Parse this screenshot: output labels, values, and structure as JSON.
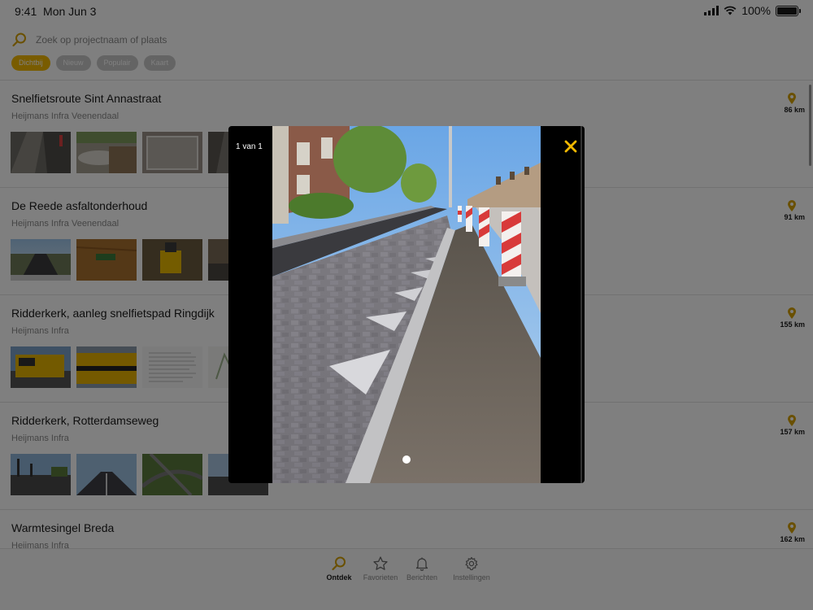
{
  "status": {
    "time": "9:41",
    "date": "Mon Jun 3",
    "battery": "100%"
  },
  "search": {
    "placeholder": "Zoek op projectnaam of plaats"
  },
  "filters": [
    {
      "label": "Dichtbij",
      "active": true
    },
    {
      "label": "Nieuw",
      "active": false
    },
    {
      "label": "Populair",
      "active": false
    },
    {
      "label": "Kaart",
      "active": false
    }
  ],
  "projects": [
    {
      "title": "Snelfietsroute Sint Annastraat",
      "company": "Heijmans Infra Veenendaal",
      "distance": "86 km"
    },
    {
      "title": "De Reede asfaltonderhoud",
      "company": "Heijmans Infra Veenendaal",
      "distance": "91 km"
    },
    {
      "title": "Ridderkerk, aanleg snelfietspad Ringdijk",
      "company": "Heijmans Infra",
      "distance": "155 km"
    },
    {
      "title": "Ridderkerk, Rotterdamseweg",
      "company": "Heijmans Infra",
      "distance": "157 km"
    },
    {
      "title": "Warmtesingel Breda",
      "company": "Heijmans Infra",
      "distance": "162 km"
    }
  ],
  "tabs": [
    {
      "label": "Ontdek",
      "icon": "search-icon",
      "active": true
    },
    {
      "label": "Favorieten",
      "icon": "star-icon",
      "active": false
    },
    {
      "label": "Berichten",
      "icon": "bell-icon",
      "active": false
    },
    {
      "label": "Instellingen",
      "icon": "gear-icon",
      "active": false
    }
  ],
  "viewer": {
    "counter": "1 van 1"
  },
  "colors": {
    "accent": "#f2b800",
    "pin": "#d4a000",
    "text": "#1a1a1a",
    "muted": "#8a8a8a"
  }
}
